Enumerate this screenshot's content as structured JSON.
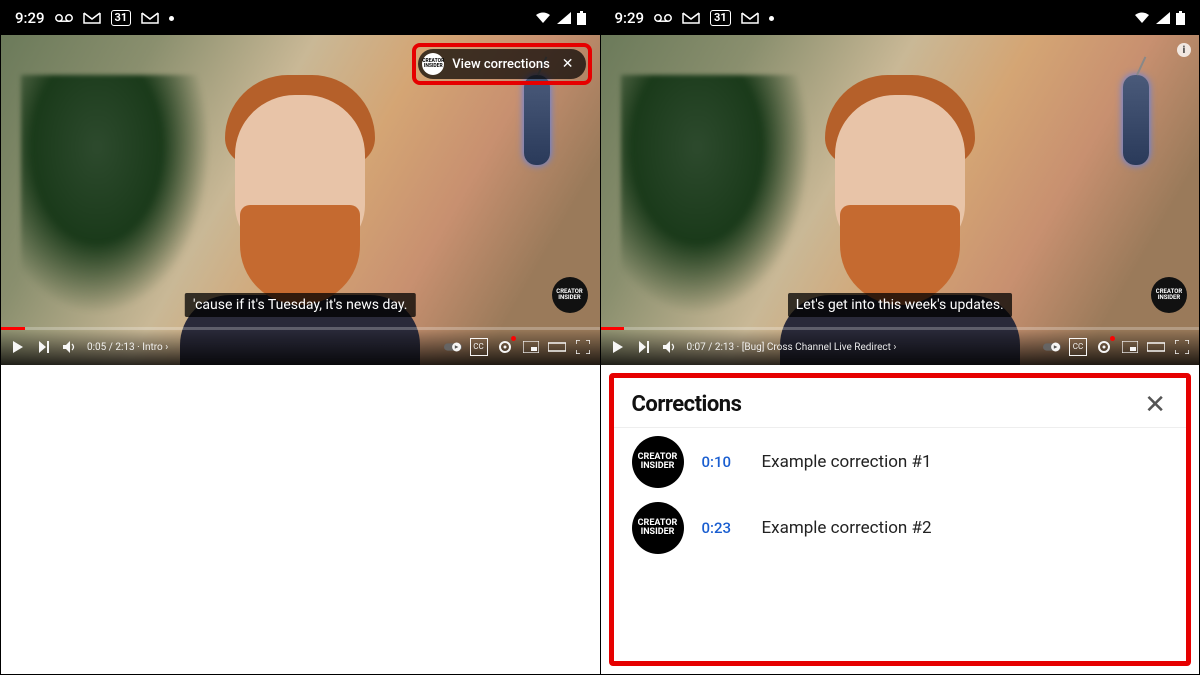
{
  "statusbar": {
    "time": "9:29",
    "voicemail_icon": "voicemail",
    "gmail_icon": "M",
    "calendar_day": "31",
    "gmail_icon2": "M",
    "wifi": true,
    "signal": true,
    "battery": true
  },
  "left_pane": {
    "chip": {
      "label": "View corrections",
      "avatar_text": "CREATOR\nINSIDER"
    },
    "caption": "'cause if it's Tuesday, it's news day.",
    "channel_badge": "CREATOR\nINSIDER",
    "controls": {
      "time_display": "0:05 / 2:13",
      "chapter": "Intro",
      "cc_label": "CC"
    }
  },
  "right_pane": {
    "caption": "Let's get into this week's updates.",
    "channel_badge": "CREATOR\nINSIDER",
    "info_dot": "i",
    "controls": {
      "time_display": "0:07 / 2:13",
      "chapter": "[Bug] Cross Channel Live Redirect",
      "cc_label": "CC"
    },
    "panel": {
      "title": "Corrections",
      "items": [
        {
          "avatar": "CREATOR\nINSIDER",
          "time": "0:10",
          "desc": "Example correction #1"
        },
        {
          "avatar": "CREATOR\nINSIDER",
          "time": "0:23",
          "desc": "Example correction #2"
        }
      ]
    }
  }
}
